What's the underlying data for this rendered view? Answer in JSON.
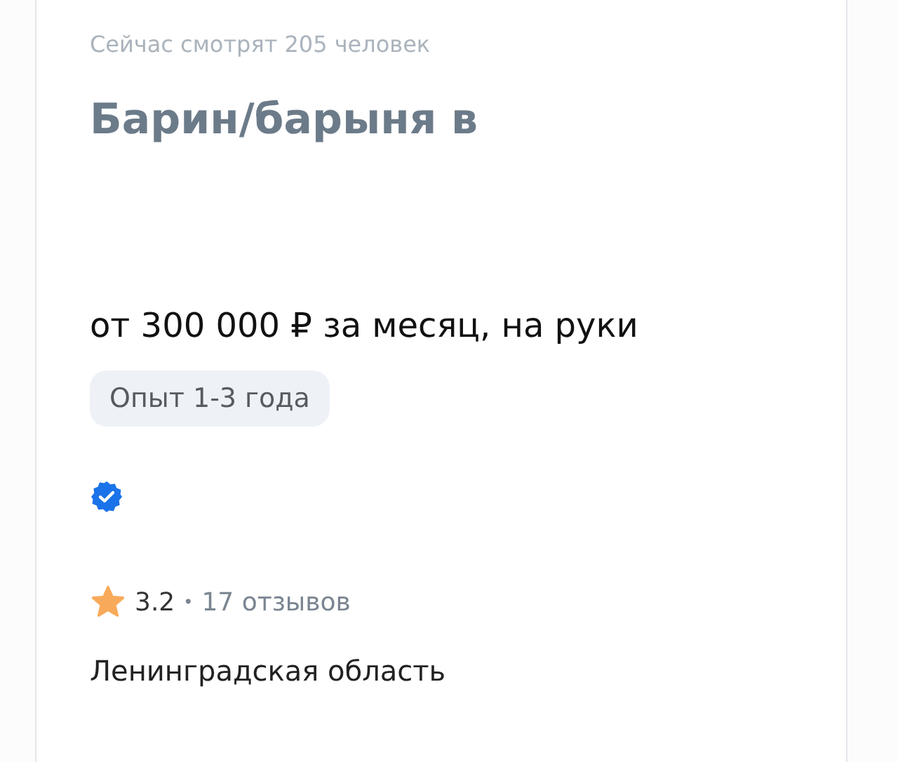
{
  "viewers": "Сейчас смотрят 205 человек",
  "title": "Барин/барыня в",
  "salary": "от 300 000 ₽ за месяц, на руки",
  "experience": "Опыт 1-3 года",
  "employer": {
    "verified": true
  },
  "rating": {
    "score": "3.2",
    "separator": "•",
    "reviews": "17 отзывов"
  },
  "region": "Ленинградская область"
}
